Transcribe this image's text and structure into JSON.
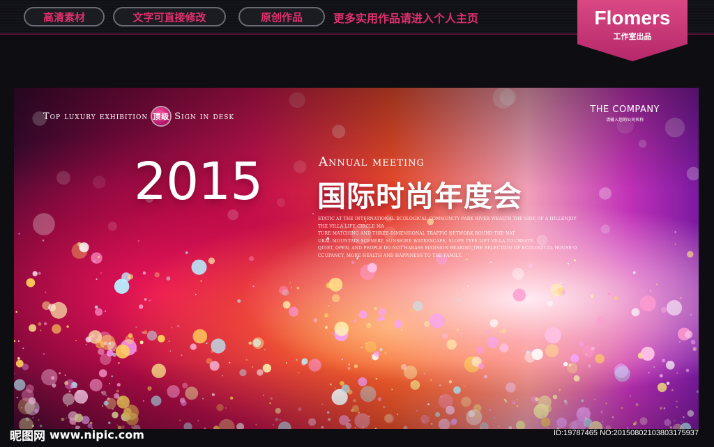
{
  "header": {
    "pills": [
      "高清素材",
      "文字可直接修改",
      "原创作品"
    ],
    "more_link": "更多实用作品请进入个人主页",
    "brand_name": "Flomers",
    "brand_sub": "工作室出品"
  },
  "banner": {
    "tagline_left_1": "Top luxury exhibition",
    "badge": "顶级",
    "tagline_left_2": "Sign in desk",
    "company_name": "THE COMPANY",
    "company_sub": "请输入您的公司名称",
    "year": "2015",
    "annual": "Annual meeting",
    "cn_title": "国际时尚年度会",
    "body_lines": [
      "STATIC AT THE INTERNATIONAL ECOLOGICAL COMMUNITY PARK RIVER WEALTH THE SIDE OF A HILLENJOY",
      "THE VILLA LIFE CIRCLE MA",
      "TURE MATCHING AND THREE-DIMENSIONAL TRAFFIC NETWORK,ROUND THE NAT",
      "URAL MOUNTAIN SCENERY, SUNSHINE WATERSCAPE, SLOPE TYPE LIFT VILLA,TO CREATE",
      "QUIET, OPEN, AND PEOPLE DO NOT HARASS MANSION BEARING,THE SELECTION OF ECOLOGICAL HOUSE O",
      "CCUPANCY, MORE HEALTH AND HAPPINESS TO THE FAMILY."
    ]
  },
  "footer": {
    "logo_text": "昵图网",
    "site": "www.nipic.com",
    "id_text": "ID:19787465 NO:20150802103803175937"
  },
  "colors": {
    "accent": "#e0306d",
    "brand_bg": "#c2306f"
  }
}
